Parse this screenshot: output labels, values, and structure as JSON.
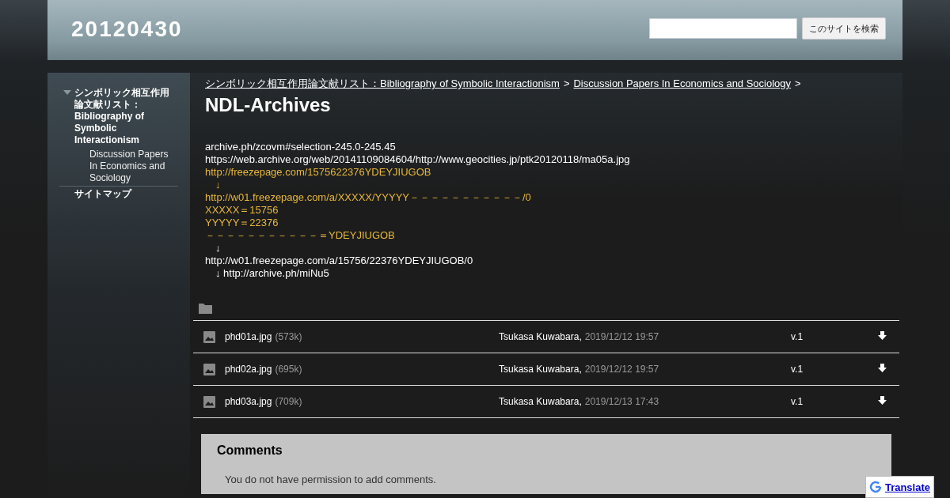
{
  "site": {
    "title": "20120430",
    "search": {
      "button": "このサイトを検索"
    }
  },
  "sidebar": {
    "items": [
      {
        "label": "シンボリック相互作用論文献リスト：Bibliography of Symbolic Interactionism",
        "expanded": true,
        "children": [
          {
            "label": "Discussion Papers In Economics and Sociology"
          }
        ]
      },
      {
        "label": "サイトマップ"
      }
    ]
  },
  "breadcrumb": [
    "シンボリック相互作用論文献リスト：Bibliography of Symbolic Interactionism",
    "Discussion Papers In Economics and Sociology"
  ],
  "breadcrumb_separator": ">",
  "page_title": "NDL-Archives",
  "body_lines": [
    {
      "text": "archive.ph/zcovm#selection-245.0-245.45",
      "highlighted": false
    },
    {
      "text": "https://web.archive.org/web/20141109084604/http://www.geocities.jp/ptk20120118/ma05a.jpg",
      "highlighted": false
    },
    {
      "text": "http://freezepage.com/1575622376YDEYJIUGOB",
      "highlighted": true
    },
    {
      "text": "　↓",
      "highlighted": true
    },
    {
      "text": "http://w01.freezepage.com/a/XXXXX/YYYYY－－－－－－－－－－－/0",
      "highlighted": true
    },
    {
      "text": "XXXXX＝15756",
      "highlighted": true
    },
    {
      "text": "YYYYY＝22376",
      "highlighted": true
    },
    {
      "text": "－－－－－－－－－－－＝YDEYJIUGOB",
      "highlighted": true
    },
    {
      "text": "　↓",
      "highlighted": false
    },
    {
      "text": "http://w01.freezepage.com/a/15756/22376YDEYJIUGOB/0",
      "highlighted": false
    },
    {
      "text": "　↓ http://archive.ph/miNu5",
      "highlighted": false
    }
  ],
  "attachments": [
    {
      "name": "phd01a.jpg",
      "size": "(573k)",
      "author": "Tsukasa Kuwabara,",
      "date": "2019/12/12 19:57",
      "version": "v.1"
    },
    {
      "name": "phd02a.jpg",
      "size": "(695k)",
      "author": "Tsukasa Kuwabara,",
      "date": "2019/12/12 19:57",
      "version": "v.1"
    },
    {
      "name": "phd03a.jpg",
      "size": "(709k)",
      "author": "Tsukasa Kuwabara,",
      "date": "2019/12/13 17:43",
      "version": "v.1"
    }
  ],
  "comments": {
    "title": "Comments",
    "message": "You do not have permission to add comments."
  },
  "translate": {
    "label": "Translate"
  }
}
